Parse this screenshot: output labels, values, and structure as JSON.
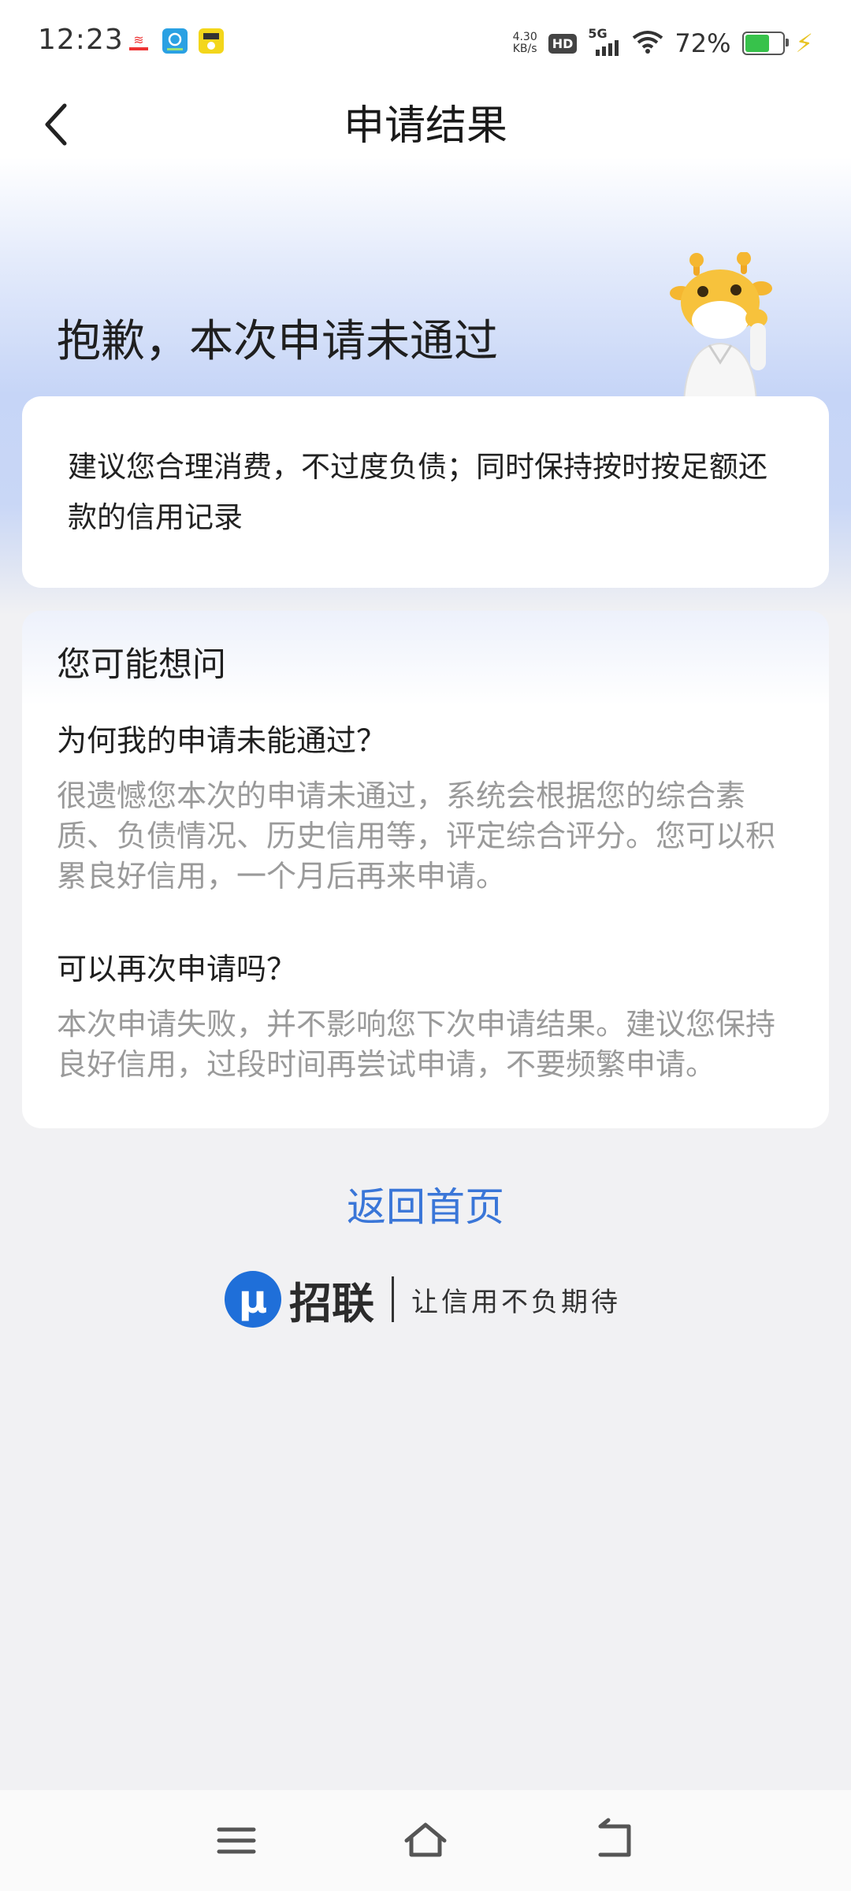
{
  "status_bar": {
    "time": "12:23",
    "app_icon_names": [
      "app-icon-1",
      "app-icon-2",
      "app-icon-3"
    ],
    "net_speed_value": "4.30",
    "net_speed_unit": "KB/s",
    "hd_label": "HD",
    "network_label": "5G",
    "battery_percent": "72%",
    "battery_level": 0.72,
    "colors": {
      "battery": "#37c24b",
      "charging": "#e8c321"
    }
  },
  "header": {
    "title": "申请结果",
    "back_icon": "chevron-left-icon"
  },
  "result": {
    "title": "抱歉，本次申请未通过",
    "mascot_icon": "giraffe-mascot"
  },
  "advice": {
    "text": "建议您合理消费，不过度负债；同时保持按时按足额还款的信用记录"
  },
  "faq": {
    "heading": "您可能想问",
    "items": [
      {
        "question": "为何我的申请未能通过？",
        "answer": "很遗憾您本次的申请未通过，系统会根据您的综合素质、负债情况、历史信用等，评定综合评分。您可以积累良好信用，一个月后再来申请。"
      },
      {
        "question": "可以再次申请吗？",
        "answer": "本次申请失败，并不影响您下次申请结果。建议您保持良好信用，过段时间再尝试申请，不要频繁申请。"
      }
    ]
  },
  "actions": {
    "home_label": "返回首页",
    "color": "#3a76d8"
  },
  "brand": {
    "logo_letter": "μ",
    "name": "招联",
    "slogan": "让信用不负期待",
    "color": "#1f6fd9"
  },
  "navbar": {
    "icons": [
      "menu-icon",
      "home-icon",
      "back-icon"
    ]
  }
}
